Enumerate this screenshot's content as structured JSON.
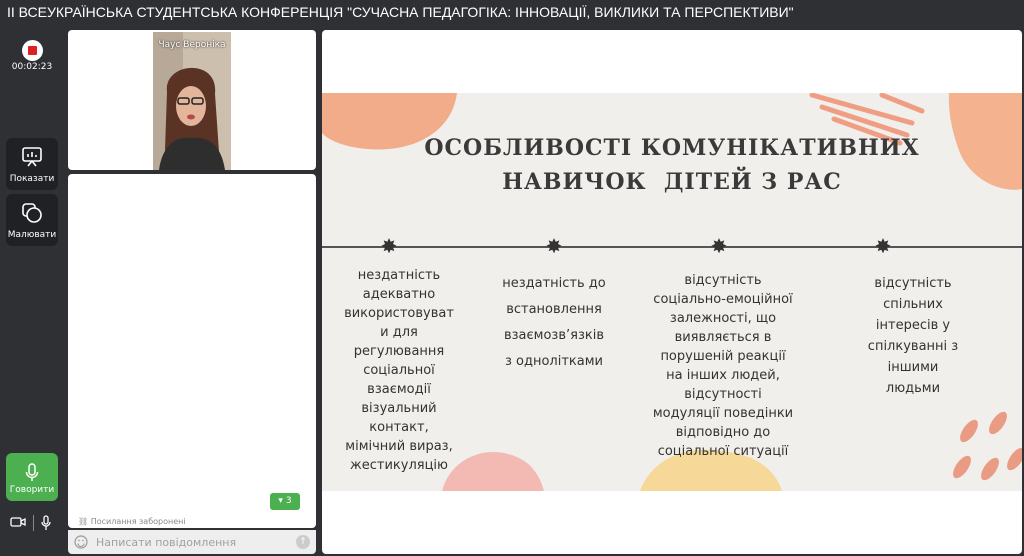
{
  "window": {
    "title": "II ВСЕУКРАЇНСЬКА СТУДЕНТСЬКА КОНФЕРЕНЦІЯ \"СУЧАСНА ПЕДАГОГІКА: ІННОВАЦІЇ, ВИКЛИКИ ТА ПЕРСПЕКТИВИ\""
  },
  "toolbar": {
    "record_time": "00:02:23",
    "show_label": "Показати",
    "draw_label": "Малювати",
    "speak_label": "Говорити"
  },
  "video": {
    "participant_name": "Чаус Вероніка"
  },
  "chat": {
    "badge_count": "3",
    "links_note": "Посилання заборонені",
    "message_placeholder": "Написати повідомлення"
  },
  "slide": {
    "title_line1": "ОСОБЛИВОСТІ КОМУНІКАТИВНИХ",
    "title_line2": "НАВИЧОК  ДІТЕЙ З РАС",
    "columns": [
      [
        "нездатність",
        "адекватно",
        "використовуват",
        "и для",
        "регулювання",
        "соціальної",
        "взаємодії",
        "візуальний",
        "контакт,",
        "мімічний вираз,",
        "жестикуляцію"
      ],
      [
        "нездатність до",
        "встановлення",
        "взаємозв’язків",
        "з однолітками"
      ],
      [
        "відсутність",
        "соціально-емоційної",
        "залежності, що",
        "виявляється в",
        "порушеній реакції",
        "на інших людей,",
        "відсутності",
        "модуляції поведінки",
        "відповідно до",
        "соціальної ситуації"
      ],
      [
        "відсутність",
        "спільних",
        "інтересів у",
        "спілкуванні з",
        "іншими",
        "людьми"
      ]
    ]
  },
  "colors": {
    "accent_green": "#4caf50",
    "record_red": "#e02020",
    "peach": "#f4a883",
    "orange": "#ef7a4e"
  }
}
